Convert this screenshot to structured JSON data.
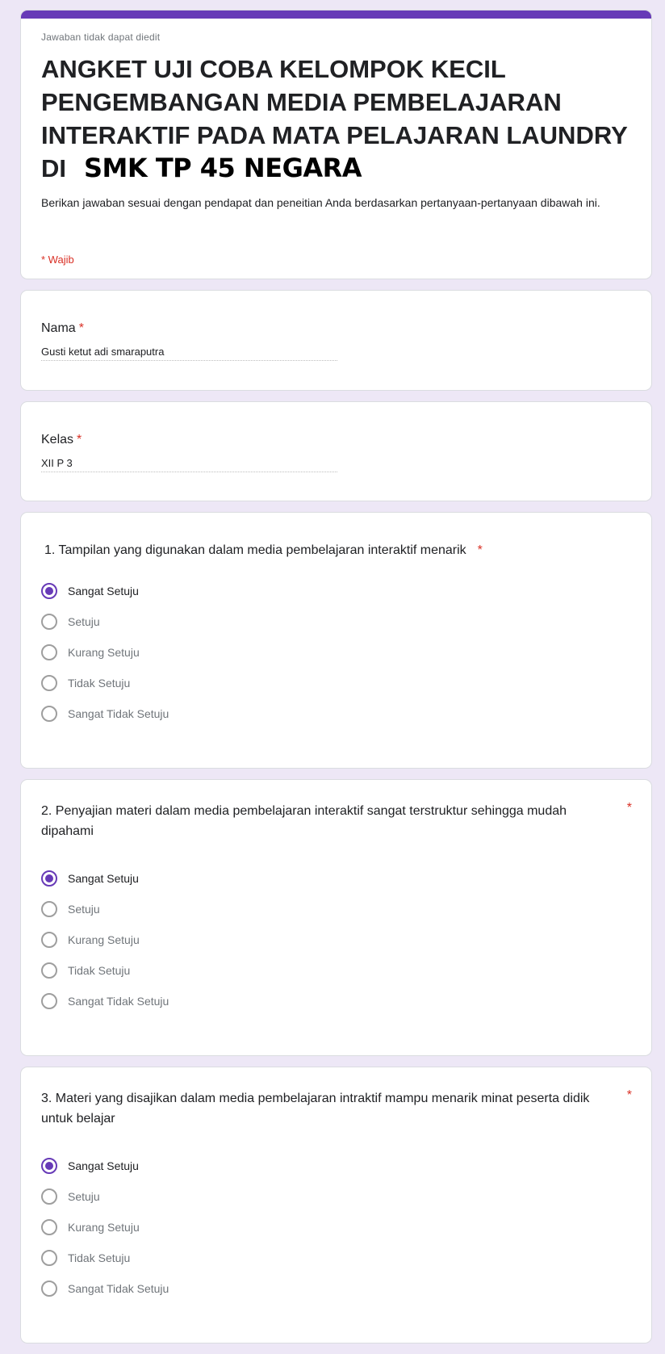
{
  "header": {
    "readonly_note": "Jawaban tidak dapat diedit",
    "title_main": "ANGKET UJI COBA KELOMPOK KECIL PENGEMBANGAN MEDIA PEMBELAJARAN INTERAKTIF PADA MATA PELAJARAN LAUNDRY DI",
    "title_tail": "SMK TP 45 NEGARA",
    "description": "Berikan jawaban sesuai dengan pendapat dan peneitian Anda berdasarkan pertanyaan-pertanyaan dibawah ini.",
    "required_note": "* Wajib",
    "accent_color": "#673ab7"
  },
  "fields": {
    "nama": {
      "label": "Nama",
      "required_mark": "*",
      "value": "Gusti ketut adi smaraputra"
    },
    "kelas": {
      "label": "Kelas",
      "required_mark": "*",
      "value": "XII P 3"
    }
  },
  "questions": [
    {
      "label": "1. Tampilan yang digunakan dalam media pembelajaran interaktif menarik",
      "required_mark": "*",
      "options": [
        "Sangat Setuju",
        "Setuju",
        "Kurang Setuju",
        "Tidak Setuju",
        "Sangat Tidak Setuju"
      ],
      "selected": "Sangat Setuju"
    },
    {
      "label": "2. Penyajian materi dalam media pembelajaran interaktif sangat terstruktur sehingga mudah dipahami",
      "required_mark": "*",
      "options": [
        "Sangat Setuju",
        "Setuju",
        "Kurang Setuju",
        "Tidak Setuju",
        "Sangat Tidak Setuju"
      ],
      "selected": "Sangat Setuju"
    },
    {
      "label": "3. Materi yang disajikan dalam media pembelajaran intraktif mampu menarik minat peserta didik untuk belajar",
      "required_mark": "*",
      "options": [
        "Sangat Setuju",
        "Setuju",
        "Kurang Setuju",
        "Tidak Setuju",
        "Sangat Tidak Setuju"
      ],
      "selected": "Sangat Setuju"
    }
  ]
}
